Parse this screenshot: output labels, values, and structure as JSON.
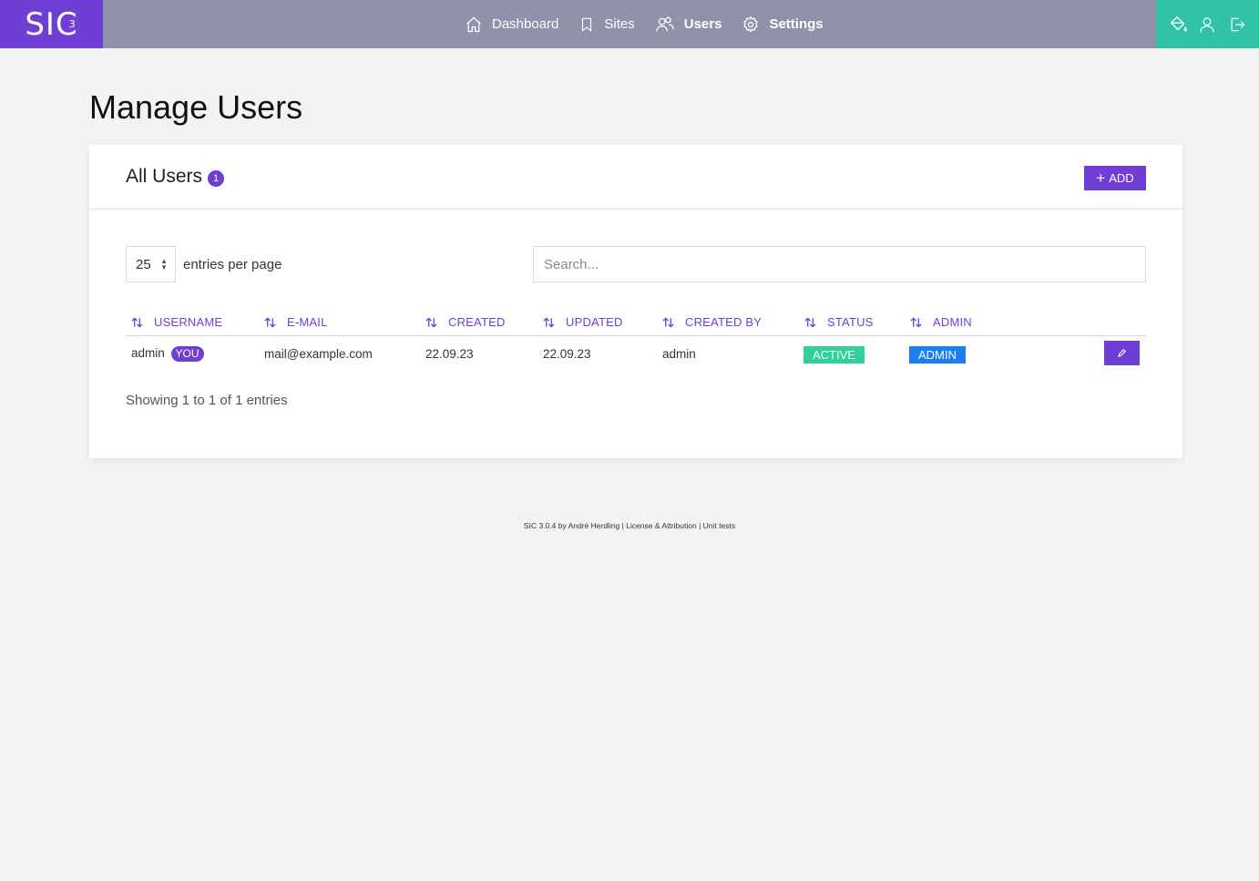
{
  "app": {
    "logo_text": "SIC",
    "logo_sup": "3"
  },
  "nav": {
    "items": [
      {
        "label": "Dashboard",
        "icon": "home-icon"
      },
      {
        "label": "Sites",
        "icon": "bookmark-icon"
      },
      {
        "label": "Users",
        "icon": "users-icon"
      },
      {
        "label": "Settings",
        "icon": "gear-icon"
      }
    ],
    "active": "Users"
  },
  "tools": [
    "theme-icon",
    "profile-icon",
    "logout-icon"
  ],
  "page": {
    "title": "Manage Users"
  },
  "card": {
    "title": "All Users",
    "count": "1",
    "add_label": "ADD"
  },
  "table_controls": {
    "per_page_value": "25",
    "per_page_label": "entries per page",
    "search_placeholder": "Search..."
  },
  "table": {
    "columns": [
      "USERNAME",
      "E-MAIL",
      "CREATED",
      "UPDATED",
      "CREATED BY",
      "STATUS",
      "ADMIN"
    ],
    "rows": [
      {
        "username": "admin",
        "you_badge": "YOU",
        "email": "mail@example.com",
        "created": "22.09.23",
        "updated": "22.09.23",
        "created_by": "admin",
        "status": "ACTIVE",
        "admin": "ADMIN"
      }
    ],
    "info": "Showing 1 to 1 of 1 entries"
  },
  "footer": {
    "text": "SIC 3.0.4 by André Herdling | License & Attribution | Unit tests"
  },
  "colors": {
    "brand": "#6f3fd5",
    "topbar": "#8f92a9",
    "tools_bg": "#2fc4a6",
    "status_active": "#2fd09a",
    "admin_badge": "#1b7ff0"
  }
}
